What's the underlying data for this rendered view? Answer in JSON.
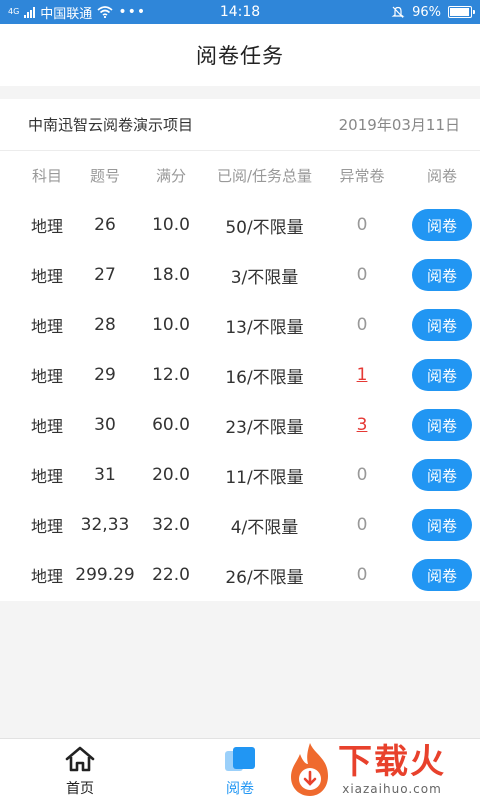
{
  "status_bar": {
    "carrier": "中国联通",
    "signal_badge": "4G",
    "time": "14:18",
    "battery": "96%",
    "battery_level": 0.96
  },
  "header": {
    "title": "阅卷任务"
  },
  "project": {
    "name": "中南迅智云阅卷演示项目",
    "date": "2019年03月11日"
  },
  "table": {
    "headers": [
      "科目",
      "题号",
      "满分",
      "已阅/任务总量",
      "异常卷",
      "阅卷"
    ],
    "rows": [
      {
        "subject": "地理",
        "question": "26",
        "score": "10.0",
        "progress": "50/不限量",
        "abnormal": "0",
        "action": "阅卷"
      },
      {
        "subject": "地理",
        "question": "27",
        "score": "18.0",
        "progress": "3/不限量",
        "abnormal": "0",
        "action": "阅卷"
      },
      {
        "subject": "地理",
        "question": "28",
        "score": "10.0",
        "progress": "13/不限量",
        "abnormal": "0",
        "action": "阅卷"
      },
      {
        "subject": "地理",
        "question": "29",
        "score": "12.0",
        "progress": "16/不限量",
        "abnormal": "1",
        "action": "阅卷"
      },
      {
        "subject": "地理",
        "question": "30",
        "score": "60.0",
        "progress": "23/不限量",
        "abnormal": "3",
        "action": "阅卷"
      },
      {
        "subject": "地理",
        "question": "31",
        "score": "20.0",
        "progress": "11/不限量",
        "abnormal": "0",
        "action": "阅卷"
      },
      {
        "subject": "地理",
        "question": "32,33",
        "score": "32.0",
        "progress": "4/不限量",
        "abnormal": "0",
        "action": "阅卷"
      },
      {
        "subject": "地理",
        "question": "299.29",
        "score": "22.0",
        "progress": "26/不限量",
        "abnormal": "0",
        "action": "阅卷"
      }
    ]
  },
  "tabbar": {
    "home_label": "首页",
    "review_label": "阅卷",
    "home_icon": "house-icon",
    "review_icon": "stacked-cards-icon"
  },
  "watermark": {
    "big": "下载火",
    "small": "xiazaihuo.com"
  },
  "colors": {
    "status_bar": "#2f86d9",
    "accent": "#2196f3",
    "abnormal": "#e53935",
    "watermark": "#e8412c"
  }
}
